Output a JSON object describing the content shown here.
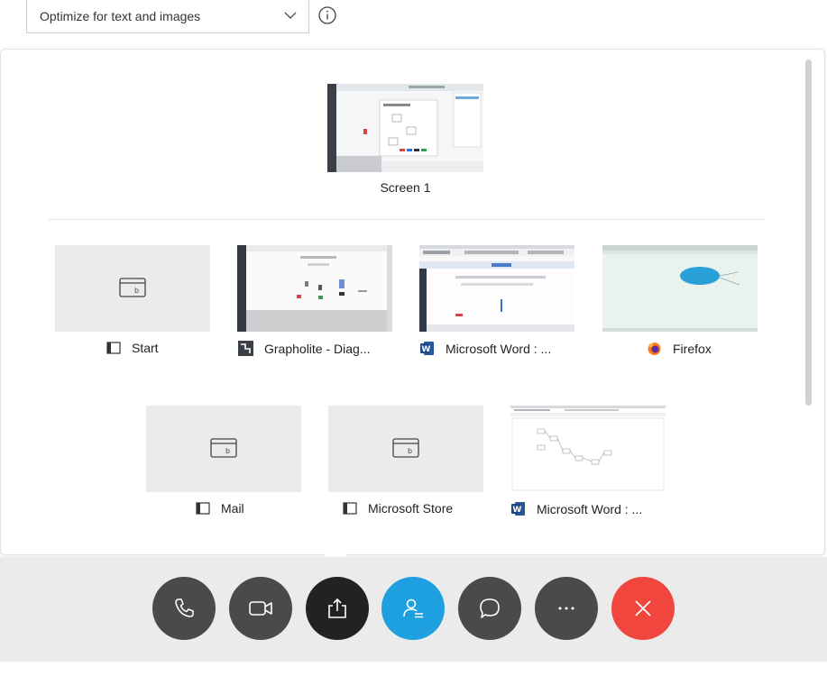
{
  "top": {
    "optimize_value": "Optimize for text and images"
  },
  "screens": [
    {
      "label": "Screen 1"
    }
  ],
  "apps_row1": [
    {
      "label": "Start",
      "icon": "generic-app-icon"
    },
    {
      "label": "Grapholite - Diag...",
      "icon": "grapholite-icon"
    },
    {
      "label": "Microsoft Word : ...",
      "icon": "word-icon"
    },
    {
      "label": "Firefox",
      "icon": "firefox-icon"
    }
  ],
  "apps_row2": [
    {
      "label": "Mail",
      "icon": "generic-app-icon"
    },
    {
      "label": "Microsoft Store",
      "icon": "generic-app-icon"
    },
    {
      "label": "Microsoft Word : ...",
      "icon": "word-icon"
    }
  ],
  "controls": [
    {
      "name": "audio",
      "icon": "phone-icon"
    },
    {
      "name": "video",
      "icon": "video-camera-icon"
    },
    {
      "name": "share",
      "icon": "share-icon"
    },
    {
      "name": "participants",
      "icon": "participants-icon"
    },
    {
      "name": "chat",
      "icon": "chat-icon"
    },
    {
      "name": "more",
      "icon": "more-icon"
    },
    {
      "name": "leave",
      "icon": "close-icon"
    }
  ],
  "colors": {
    "share_active": "#222222",
    "participants_blue": "#1e9fe0",
    "leave_red": "#f0463d",
    "control_gray": "#4a4a4a",
    "word_blue": "#2b579a"
  }
}
